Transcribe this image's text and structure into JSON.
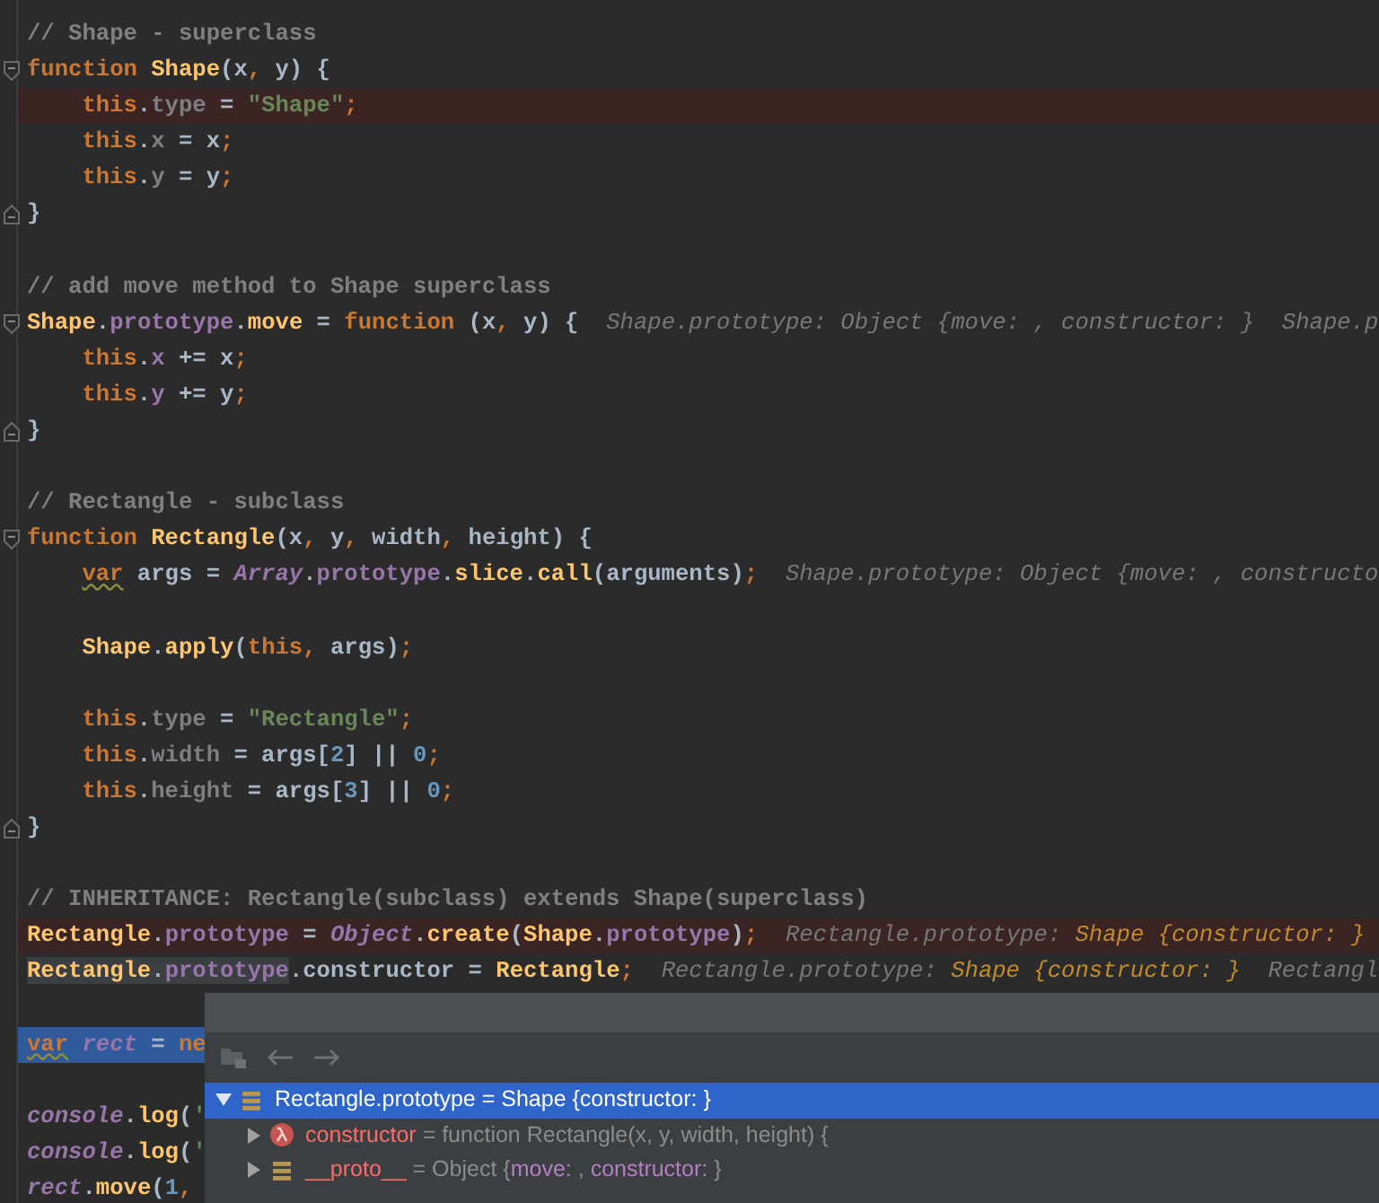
{
  "editor": {
    "lines": [
      {
        "tokens": [
          {
            "kind": "comment",
            "text": "// Shape - superclass"
          }
        ]
      },
      {
        "fold_start": true,
        "tokens": [
          {
            "kind": "kw",
            "text": "function "
          },
          {
            "kind": "fn",
            "text": "Shape"
          },
          {
            "kind": "plain",
            "text": "(x"
          },
          {
            "kind": "kw",
            "text": ","
          },
          {
            "kind": "plain",
            "text": " y) {"
          }
        ]
      },
      {
        "error": true,
        "indented": true,
        "tokens": [
          {
            "kind": "kw",
            "text": "this"
          },
          {
            "kind": "plain",
            "text": "."
          },
          {
            "kind": "dim",
            "text": "type"
          },
          {
            "kind": "plain",
            "text": " = "
          },
          {
            "kind": "str",
            "text": "\"Shape\""
          },
          {
            "kind": "kw",
            "text": ";"
          }
        ]
      },
      {
        "indented": true,
        "tokens": [
          {
            "kind": "kw",
            "text": "this"
          },
          {
            "kind": "plain",
            "text": "."
          },
          {
            "kind": "dim",
            "text": "x"
          },
          {
            "kind": "plain",
            "text": " = x"
          },
          {
            "kind": "kw",
            "text": ";"
          }
        ]
      },
      {
        "indented": true,
        "tokens": [
          {
            "kind": "kw",
            "text": "this"
          },
          {
            "kind": "plain",
            "text": "."
          },
          {
            "kind": "dim",
            "text": "y"
          },
          {
            "kind": "plain",
            "text": " = y"
          },
          {
            "kind": "kw",
            "text": ";"
          }
        ]
      },
      {
        "fold_end": true,
        "tokens": [
          {
            "kind": "plain",
            "text": "}"
          }
        ]
      },
      {
        "gap_before": true,
        "tokens": [
          {
            "kind": "comment",
            "text": "// add move method to Shape superclass"
          }
        ]
      },
      {
        "fold_start": true,
        "tokens": [
          {
            "kind": "fn",
            "text": "Shape"
          },
          {
            "kind": "plain",
            "text": "."
          },
          {
            "kind": "prop",
            "text": "prototype"
          },
          {
            "kind": "plain",
            "text": "."
          },
          {
            "kind": "fn",
            "text": "move"
          },
          {
            "kind": "plain",
            "text": " = "
          },
          {
            "kind": "kw",
            "text": "function"
          },
          {
            "kind": "plain",
            "text": " (x"
          },
          {
            "kind": "kw",
            "text": ","
          },
          {
            "kind": "plain",
            "text": " y) {"
          }
        ],
        "hints": [
          [
            {
              "kind": "hint",
              "text": "Shape.prototype: Object {move: , constructor: }"
            }
          ],
          [
            {
              "kind": "hint",
              "text": "Shape.p"
            }
          ]
        ]
      },
      {
        "indented": true,
        "tokens": [
          {
            "kind": "kw",
            "text": "this"
          },
          {
            "kind": "plain",
            "text": "."
          },
          {
            "kind": "prop",
            "text": "x"
          },
          {
            "kind": "plain",
            "text": " += x"
          },
          {
            "kind": "kw",
            "text": ";"
          }
        ]
      },
      {
        "indented": true,
        "tokens": [
          {
            "kind": "kw",
            "text": "this"
          },
          {
            "kind": "plain",
            "text": "."
          },
          {
            "kind": "prop",
            "text": "y"
          },
          {
            "kind": "plain",
            "text": " += y"
          },
          {
            "kind": "kw",
            "text": ";"
          }
        ]
      },
      {
        "fold_end": true,
        "tokens": [
          {
            "kind": "plain",
            "text": "}"
          }
        ]
      },
      {
        "gap_before": true,
        "tokens": [
          {
            "kind": "comment",
            "text": "// Rectangle - subclass"
          }
        ]
      },
      {
        "fold_start": true,
        "tokens": [
          {
            "kind": "kw",
            "text": "function "
          },
          {
            "kind": "fn",
            "text": "Rectangle"
          },
          {
            "kind": "plain",
            "text": "(x"
          },
          {
            "kind": "kw",
            "text": ","
          },
          {
            "kind": "plain",
            "text": " y"
          },
          {
            "kind": "kw",
            "text": ","
          },
          {
            "kind": "plain",
            "text": " width"
          },
          {
            "kind": "kw",
            "text": ","
          },
          {
            "kind": "plain",
            "text": " height) {"
          }
        ]
      },
      {
        "indented": true,
        "tokens": [
          {
            "kind": "kw",
            "text": "var",
            "warning": true
          },
          {
            "kind": "plain",
            "text": " args = "
          },
          {
            "kind": "global",
            "text": "Array"
          },
          {
            "kind": "plain",
            "text": "."
          },
          {
            "kind": "prop",
            "text": "prototype"
          },
          {
            "kind": "plain",
            "text": "."
          },
          {
            "kind": "fn",
            "text": "slice"
          },
          {
            "kind": "plain",
            "text": "."
          },
          {
            "kind": "fn",
            "text": "call"
          },
          {
            "kind": "plain",
            "text": "(arguments)"
          },
          {
            "kind": "kw",
            "text": ";"
          }
        ],
        "hints": [
          [
            {
              "kind": "hint",
              "text": "Shape.prototype: Object {move: , constructo"
            }
          ]
        ]
      },
      {
        "gap_before": true,
        "indented": true,
        "tokens": [
          {
            "kind": "fn",
            "text": "Shape"
          },
          {
            "kind": "plain",
            "text": "."
          },
          {
            "kind": "fn",
            "text": "apply"
          },
          {
            "kind": "plain",
            "text": "("
          },
          {
            "kind": "kw",
            "text": "this,"
          },
          {
            "kind": "plain",
            "text": " args)"
          },
          {
            "kind": "kw",
            "text": ";"
          }
        ]
      },
      {
        "gap_before": true,
        "indented": true,
        "tokens": [
          {
            "kind": "kw",
            "text": "this"
          },
          {
            "kind": "plain",
            "text": "."
          },
          {
            "kind": "dim",
            "text": "type"
          },
          {
            "kind": "plain",
            "text": " = "
          },
          {
            "kind": "str",
            "text": "\"Rectangle\""
          },
          {
            "kind": "kw",
            "text": ";"
          }
        ]
      },
      {
        "indented": true,
        "tokens": [
          {
            "kind": "kw",
            "text": "this"
          },
          {
            "kind": "plain",
            "text": "."
          },
          {
            "kind": "dim",
            "text": "width"
          },
          {
            "kind": "plain",
            "text": " = args["
          },
          {
            "kind": "num",
            "text": "2"
          },
          {
            "kind": "plain",
            "text": "] || "
          },
          {
            "kind": "num",
            "text": "0"
          },
          {
            "kind": "kw",
            "text": ";"
          }
        ]
      },
      {
        "indented": true,
        "tokens": [
          {
            "kind": "kw",
            "text": "this"
          },
          {
            "kind": "plain",
            "text": "."
          },
          {
            "kind": "dim",
            "text": "height"
          },
          {
            "kind": "plain",
            "text": " = args["
          },
          {
            "kind": "num",
            "text": "3"
          },
          {
            "kind": "plain",
            "text": "] || "
          },
          {
            "kind": "num",
            "text": "0"
          },
          {
            "kind": "kw",
            "text": ";"
          }
        ]
      },
      {
        "fold_end": true,
        "tokens": [
          {
            "kind": "plain",
            "text": "}"
          }
        ]
      },
      {
        "gap_before": true,
        "tokens": [
          {
            "kind": "comment",
            "text": "// INHERITANCE: Rectangle(subclass) extends Shape(superclass)"
          }
        ]
      },
      {
        "error": true,
        "tokens": [
          {
            "kind": "fn",
            "text": "Rectangle"
          },
          {
            "kind": "plain",
            "text": "."
          },
          {
            "kind": "prop",
            "text": "prototype"
          },
          {
            "kind": "plain",
            "text": " = "
          },
          {
            "kind": "global",
            "text": "Object"
          },
          {
            "kind": "plain",
            "text": "."
          },
          {
            "kind": "fn",
            "text": "create"
          },
          {
            "kind": "plain",
            "text": "("
          },
          {
            "kind": "fn",
            "text": "Shape"
          },
          {
            "kind": "plain",
            "text": "."
          },
          {
            "kind": "prop",
            "text": "prototype"
          },
          {
            "kind": "plain",
            "text": ")"
          },
          {
            "kind": "kw",
            "text": ";"
          }
        ],
        "hints": [
          [
            {
              "kind": "hint",
              "text": "Rectangle.prototype: "
            },
            {
              "kind": "hint-type",
              "text": "Shape {constructor: }"
            }
          ]
        ]
      },
      {
        "tokens": [
          {
            "kind": "fn",
            "text": "Rectangle",
            "marked": true
          },
          {
            "kind": "plain",
            "text": ".",
            "marked": true
          },
          {
            "kind": "prop",
            "text": "prototype",
            "marked": true
          },
          {
            "kind": "plain",
            "text": ".constructor = "
          },
          {
            "kind": "fn",
            "text": "Rectangle"
          },
          {
            "kind": "kw",
            "text": ";"
          }
        ],
        "hints": [
          [
            {
              "kind": "hint",
              "text": "Rectangle.prototype: "
            },
            {
              "kind": "hint-type",
              "text": "Shape {constructor: }"
            }
          ],
          [
            {
              "kind": "hint",
              "text": "Rectangl"
            }
          ]
        ]
      },
      {
        "gap_before": true,
        "selected": true,
        "tokens": [
          {
            "kind": "kw",
            "text": "var",
            "warning": true
          },
          {
            "kind": "global",
            "text": " rect"
          },
          {
            "kind": "plain",
            "text": " = "
          },
          {
            "kind": "kw",
            "text": "ne"
          }
        ]
      },
      {
        "gap_before": true,
        "tokens": [
          {
            "kind": "global",
            "text": "console"
          },
          {
            "kind": "plain",
            "text": "."
          },
          {
            "kind": "fn",
            "text": "log"
          },
          {
            "kind": "plain",
            "text": "("
          },
          {
            "kind": "str",
            "text": "'"
          }
        ]
      },
      {
        "tokens": [
          {
            "kind": "global",
            "text": "console"
          },
          {
            "kind": "plain",
            "text": "."
          },
          {
            "kind": "fn",
            "text": "log"
          },
          {
            "kind": "plain",
            "text": "("
          },
          {
            "kind": "str",
            "text": "'"
          }
        ]
      },
      {
        "tokens": [
          {
            "kind": "global",
            "text": "rect"
          },
          {
            "kind": "plain",
            "text": "."
          },
          {
            "kind": "fn",
            "text": "move"
          },
          {
            "kind": "plain",
            "text": "("
          },
          {
            "kind": "num",
            "text": "1"
          },
          {
            "kind": "kw",
            "text": ","
          }
        ]
      }
    ]
  },
  "popup": {
    "tree": [
      {
        "kind": "object",
        "expanded": true,
        "selected": true,
        "parts": [
          {
            "kind": "title",
            "text": "Rectangle.prototype = Shape {constructor: }"
          }
        ],
        "children": [
          {
            "kind": "function",
            "expanded": false,
            "selected": false,
            "parts": [
              {
                "kind": "name",
                "text": "constructor"
              },
              {
                "kind": "value",
                "text": " = function Rectangle(x, y, width, height) {"
              }
            ]
          },
          {
            "kind": "object",
            "expanded": false,
            "selected": false,
            "parts": [
              {
                "kind": "name",
                "text": "__proto__"
              },
              {
                "kind": "value",
                "text": " = Object {"
              },
              {
                "kind": "key",
                "text": "move:"
              },
              {
                "kind": "value",
                "text": " , "
              },
              {
                "kind": "key",
                "text": "constructor:"
              },
              {
                "kind": "value",
                "text": " }"
              }
            ]
          }
        ]
      }
    ]
  }
}
